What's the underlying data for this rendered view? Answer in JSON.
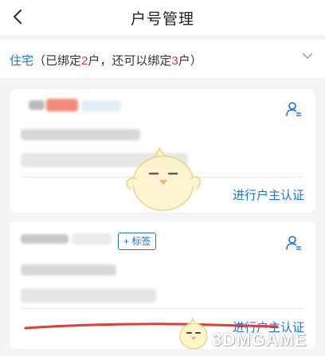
{
  "header": {
    "title": "户号管理"
  },
  "section": {
    "home_label": "住宅",
    "bound_prefix": "（已绑定",
    "bound_count": "2",
    "bound_mid": "户，还可以绑定",
    "remaining_count": "3",
    "bound_suffix": "户）"
  },
  "cards": [
    {
      "action_label": "进行户主认证"
    },
    {
      "tag_label": "+ 标签",
      "action_label": "进行户主认证"
    }
  ],
  "colors": {
    "accent": "#1a73e8",
    "count_red": "#e53935",
    "background": "#f3f4f6"
  },
  "icons": {
    "back": "chevron-left-icon",
    "collapse": "chevron-down-icon",
    "user": "user-settings-icon"
  },
  "watermark": {
    "text": "3DMGAME"
  }
}
